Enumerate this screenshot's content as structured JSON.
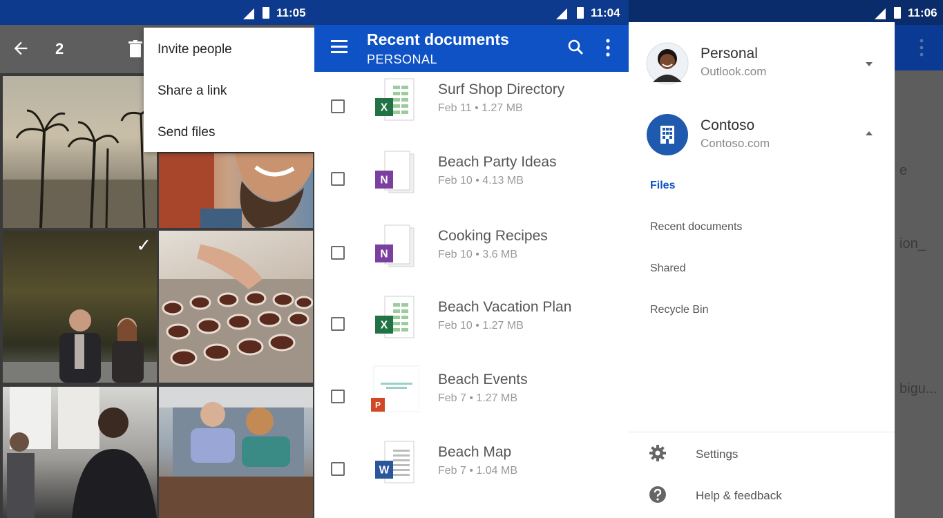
{
  "panel1": {
    "status_time": "11:05",
    "selected_count": "2",
    "menu": [
      "Invite people",
      "Share a link",
      "Send files"
    ],
    "selected_mark": "✓"
  },
  "panel2": {
    "status_time": "11:04",
    "title": "Recent documents",
    "subtitle": "PERSONAL",
    "files": [
      {
        "name": "Surf Shop Directory",
        "meta": "Feb 11 • 1.27 MB",
        "type": "excel",
        "badge": "X"
      },
      {
        "name": "Beach Party Ideas",
        "meta": "Feb 10 • 4.13 MB",
        "type": "onenote",
        "badge": "N"
      },
      {
        "name": "Cooking Recipes",
        "meta": "Feb 10 • 3.6 MB",
        "type": "onenote",
        "badge": "N"
      },
      {
        "name": "Beach Vacation Plan",
        "meta": "Feb 10 • 1.27 MB",
        "type": "excel",
        "badge": "X"
      },
      {
        "name": "Beach Events",
        "meta": "Feb 7 • 1.27 MB",
        "type": "powerpoint",
        "badge": "P"
      },
      {
        "name": "Beach Map",
        "meta": "Feb 7 • 1.04 MB",
        "type": "word",
        "badge": "W"
      }
    ]
  },
  "panel3": {
    "status_time": "11:06",
    "behind_text": [
      "e",
      "ion_",
      "bigu..."
    ],
    "accounts": [
      {
        "name": "Personal",
        "email": "Outlook.com"
      },
      {
        "name": "Contoso",
        "email": "Contoso.com"
      }
    ],
    "nav": [
      "Files",
      "Recent documents",
      "Shared",
      "Recycle Bin"
    ],
    "footer": [
      "Settings",
      "Help & feedback"
    ]
  },
  "colors": {
    "status_bar": "#0d3a8c",
    "app_bar": "#0f52c6",
    "excel": "#217346",
    "onenote": "#7b3fa0",
    "powerpoint": "#d24726",
    "word": "#2b579a"
  }
}
